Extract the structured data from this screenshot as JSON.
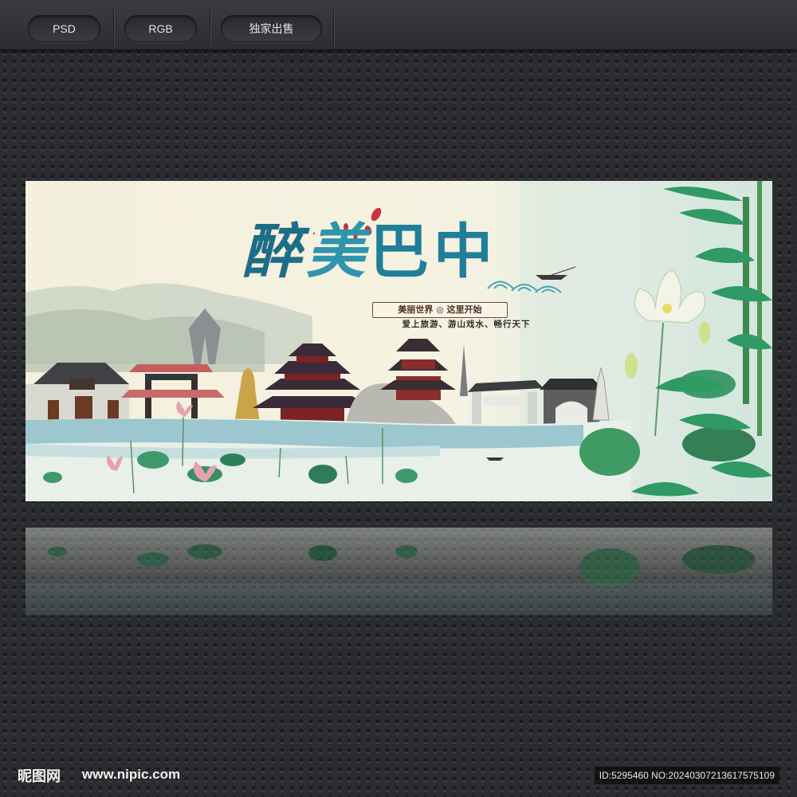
{
  "tags": {
    "format": "PSD",
    "color_mode": "RGB",
    "exclusive": "独家出售"
  },
  "banner": {
    "title_char1": "醉",
    "title_char2": "美",
    "title_char3": "巴",
    "title_char4": "中",
    "slogan": "美丽世界 ◎ 这里开始",
    "subline": "爱上旅游、游山戏水、畅行天下",
    "colors": {
      "title_teal": "#1f7e98",
      "water": "#9cc7cf",
      "bamboo": "#2f9a63",
      "lotus_leaf": "#3e9a6a",
      "temple_roof": "#3b2b38",
      "temple_wall": "#8b2a2a"
    }
  },
  "footer": {
    "logo": "昵图网",
    "url": "www.nipic.com",
    "id_text": "ID:5295460 NO:20240307213617575109"
  }
}
